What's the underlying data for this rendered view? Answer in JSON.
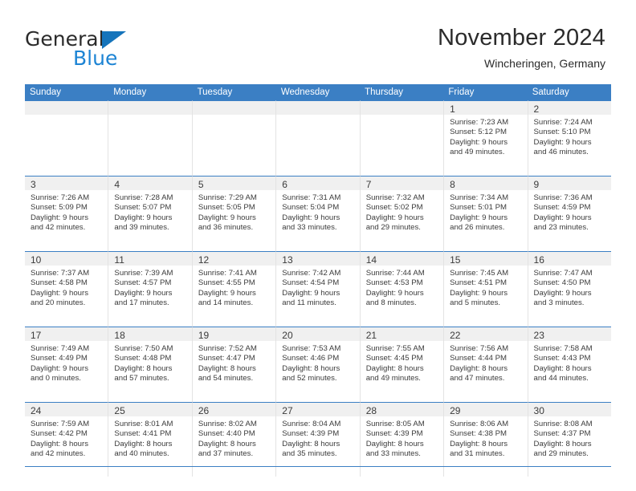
{
  "brand": {
    "word_one": "General",
    "word_two": "Blue",
    "logo_icon": "triangle-logo-icon",
    "accent_color": "#1574bb"
  },
  "header": {
    "title": "November 2024",
    "subtitle": "Wincheringen, Germany"
  },
  "calendar": {
    "header_color": "#3b7fc4",
    "weekdays": [
      "Sunday",
      "Monday",
      "Tuesday",
      "Wednesday",
      "Thursday",
      "Friday",
      "Saturday"
    ],
    "weeks": [
      [
        {
          "day": "",
          "lines": []
        },
        {
          "day": "",
          "lines": []
        },
        {
          "day": "",
          "lines": []
        },
        {
          "day": "",
          "lines": []
        },
        {
          "day": "",
          "lines": []
        },
        {
          "day": "1",
          "lines": [
            "Sunrise: 7:23 AM",
            "Sunset: 5:12 PM",
            "Daylight: 9 hours",
            "and 49 minutes."
          ]
        },
        {
          "day": "2",
          "lines": [
            "Sunrise: 7:24 AM",
            "Sunset: 5:10 PM",
            "Daylight: 9 hours",
            "and 46 minutes."
          ]
        }
      ],
      [
        {
          "day": "3",
          "lines": [
            "Sunrise: 7:26 AM",
            "Sunset: 5:09 PM",
            "Daylight: 9 hours",
            "and 42 minutes."
          ]
        },
        {
          "day": "4",
          "lines": [
            "Sunrise: 7:28 AM",
            "Sunset: 5:07 PM",
            "Daylight: 9 hours",
            "and 39 minutes."
          ]
        },
        {
          "day": "5",
          "lines": [
            "Sunrise: 7:29 AM",
            "Sunset: 5:05 PM",
            "Daylight: 9 hours",
            "and 36 minutes."
          ]
        },
        {
          "day": "6",
          "lines": [
            "Sunrise: 7:31 AM",
            "Sunset: 5:04 PM",
            "Daylight: 9 hours",
            "and 33 minutes."
          ]
        },
        {
          "day": "7",
          "lines": [
            "Sunrise: 7:32 AM",
            "Sunset: 5:02 PM",
            "Daylight: 9 hours",
            "and 29 minutes."
          ]
        },
        {
          "day": "8",
          "lines": [
            "Sunrise: 7:34 AM",
            "Sunset: 5:01 PM",
            "Daylight: 9 hours",
            "and 26 minutes."
          ]
        },
        {
          "day": "9",
          "lines": [
            "Sunrise: 7:36 AM",
            "Sunset: 4:59 PM",
            "Daylight: 9 hours",
            "and 23 minutes."
          ]
        }
      ],
      [
        {
          "day": "10",
          "lines": [
            "Sunrise: 7:37 AM",
            "Sunset: 4:58 PM",
            "Daylight: 9 hours",
            "and 20 minutes."
          ]
        },
        {
          "day": "11",
          "lines": [
            "Sunrise: 7:39 AM",
            "Sunset: 4:57 PM",
            "Daylight: 9 hours",
            "and 17 minutes."
          ]
        },
        {
          "day": "12",
          "lines": [
            "Sunrise: 7:41 AM",
            "Sunset: 4:55 PM",
            "Daylight: 9 hours",
            "and 14 minutes."
          ]
        },
        {
          "day": "13",
          "lines": [
            "Sunrise: 7:42 AM",
            "Sunset: 4:54 PM",
            "Daylight: 9 hours",
            "and 11 minutes."
          ]
        },
        {
          "day": "14",
          "lines": [
            "Sunrise: 7:44 AM",
            "Sunset: 4:53 PM",
            "Daylight: 9 hours",
            "and 8 minutes."
          ]
        },
        {
          "day": "15",
          "lines": [
            "Sunrise: 7:45 AM",
            "Sunset: 4:51 PM",
            "Daylight: 9 hours",
            "and 5 minutes."
          ]
        },
        {
          "day": "16",
          "lines": [
            "Sunrise: 7:47 AM",
            "Sunset: 4:50 PM",
            "Daylight: 9 hours",
            "and 3 minutes."
          ]
        }
      ],
      [
        {
          "day": "17",
          "lines": [
            "Sunrise: 7:49 AM",
            "Sunset: 4:49 PM",
            "Daylight: 9 hours",
            "and 0 minutes."
          ]
        },
        {
          "day": "18",
          "lines": [
            "Sunrise: 7:50 AM",
            "Sunset: 4:48 PM",
            "Daylight: 8 hours",
            "and 57 minutes."
          ]
        },
        {
          "day": "19",
          "lines": [
            "Sunrise: 7:52 AM",
            "Sunset: 4:47 PM",
            "Daylight: 8 hours",
            "and 54 minutes."
          ]
        },
        {
          "day": "20",
          "lines": [
            "Sunrise: 7:53 AM",
            "Sunset: 4:46 PM",
            "Daylight: 8 hours",
            "and 52 minutes."
          ]
        },
        {
          "day": "21",
          "lines": [
            "Sunrise: 7:55 AM",
            "Sunset: 4:45 PM",
            "Daylight: 8 hours",
            "and 49 minutes."
          ]
        },
        {
          "day": "22",
          "lines": [
            "Sunrise: 7:56 AM",
            "Sunset: 4:44 PM",
            "Daylight: 8 hours",
            "and 47 minutes."
          ]
        },
        {
          "day": "23",
          "lines": [
            "Sunrise: 7:58 AM",
            "Sunset: 4:43 PM",
            "Daylight: 8 hours",
            "and 44 minutes."
          ]
        }
      ],
      [
        {
          "day": "24",
          "lines": [
            "Sunrise: 7:59 AM",
            "Sunset: 4:42 PM",
            "Daylight: 8 hours",
            "and 42 minutes."
          ]
        },
        {
          "day": "25",
          "lines": [
            "Sunrise: 8:01 AM",
            "Sunset: 4:41 PM",
            "Daylight: 8 hours",
            "and 40 minutes."
          ]
        },
        {
          "day": "26",
          "lines": [
            "Sunrise: 8:02 AM",
            "Sunset: 4:40 PM",
            "Daylight: 8 hours",
            "and 37 minutes."
          ]
        },
        {
          "day": "27",
          "lines": [
            "Sunrise: 8:04 AM",
            "Sunset: 4:39 PM",
            "Daylight: 8 hours",
            "and 35 minutes."
          ]
        },
        {
          "day": "28",
          "lines": [
            "Sunrise: 8:05 AM",
            "Sunset: 4:39 PM",
            "Daylight: 8 hours",
            "and 33 minutes."
          ]
        },
        {
          "day": "29",
          "lines": [
            "Sunrise: 8:06 AM",
            "Sunset: 4:38 PM",
            "Daylight: 8 hours",
            "and 31 minutes."
          ]
        },
        {
          "day": "30",
          "lines": [
            "Sunrise: 8:08 AM",
            "Sunset: 4:37 PM",
            "Daylight: 8 hours",
            "and 29 minutes."
          ]
        }
      ]
    ]
  }
}
